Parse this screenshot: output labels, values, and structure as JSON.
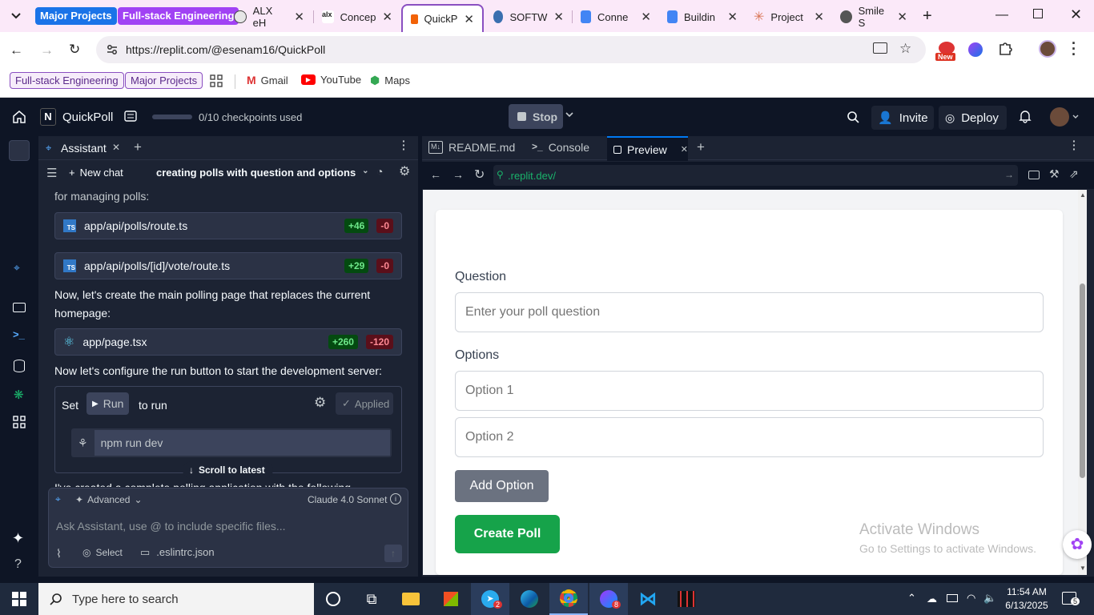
{
  "browser": {
    "groups": [
      "Major Projects",
      "Full-stack Engineering"
    ],
    "tabs": [
      {
        "label": "ALX eH"
      },
      {
        "label": "Concep"
      },
      {
        "label": "QuickP"
      },
      {
        "label": "SOFTW"
      },
      {
        "label": "Conne"
      },
      {
        "label": "Buildin"
      },
      {
        "label": "Project"
      },
      {
        "label": "Smile S"
      }
    ],
    "url": "https://replit.com/@esenam16/QuickPoll",
    "new_badge": "New",
    "bookmarks": {
      "group1": "Full-stack Engineering",
      "group2": "Major Projects",
      "links": [
        "Gmail",
        "YouTube",
        "Maps"
      ]
    }
  },
  "replit": {
    "project_name": "QuickPoll",
    "checkpoints": "0/10 checkpoints used",
    "stop_label": "Stop",
    "invite_label": "Invite",
    "deploy_label": "Deploy"
  },
  "assistant": {
    "tab_label": "Assistant",
    "new_chat": "New chat",
    "chat_title": "creating polls with question and options",
    "intro_text": "for managing polls:",
    "files": [
      {
        "name": "app/api/polls/route.ts",
        "add": "+46",
        "del": "-0"
      },
      {
        "name": "app/api/polls/[id]/vote/route.ts",
        "add": "+29",
        "del": "-0"
      },
      {
        "name": "app/page.tsx",
        "add": "+260",
        "del": "-120"
      }
    ],
    "msg1": "Now, let's create the main polling page that replaces the current homepage:",
    "msg2": "Now let's configure the run button to start the development server:",
    "set_label": "Set",
    "run_label": "Run",
    "to_run": "to run",
    "applied": "Applied",
    "command": "npm run dev",
    "scroll_latest": "Scroll to latest",
    "partial_text": "I've created a complete polling application with the following",
    "advanced": "Advanced",
    "model": "Claude 4.0 Sonnet",
    "input_placeholder": "Ask Assistant, use @ to include specific files...",
    "select_label": "Select",
    "attached_file": ".eslintrc.json"
  },
  "editor_tabs": [
    "README.md",
    "Console",
    "Preview"
  ],
  "preview": {
    "url": ".replit.dev/",
    "question_label": "Question",
    "question_placeholder": "Enter your poll question",
    "options_label": "Options",
    "option1_placeholder": "Option 1",
    "option2_placeholder": "Option 2",
    "add_option": "Add Option",
    "create_poll": "Create Poll",
    "watermark_title": "Activate Windows",
    "watermark_sub": "Go to Settings to activate Windows."
  },
  "taskbar": {
    "search_placeholder": "Type here to search",
    "time": "11:54 AM",
    "date": "6/13/2025",
    "badge_telegram": "2",
    "badge_other": "8",
    "notification_count": "5"
  },
  "colors": {
    "replit_bg": "#0e1525",
    "panel_bg": "#1c2333",
    "create_poll": "#16a34a",
    "add_option": "#6b7280",
    "tab_group_major": "#1a73e8",
    "tab_group_fullstack": "#a142f4"
  }
}
